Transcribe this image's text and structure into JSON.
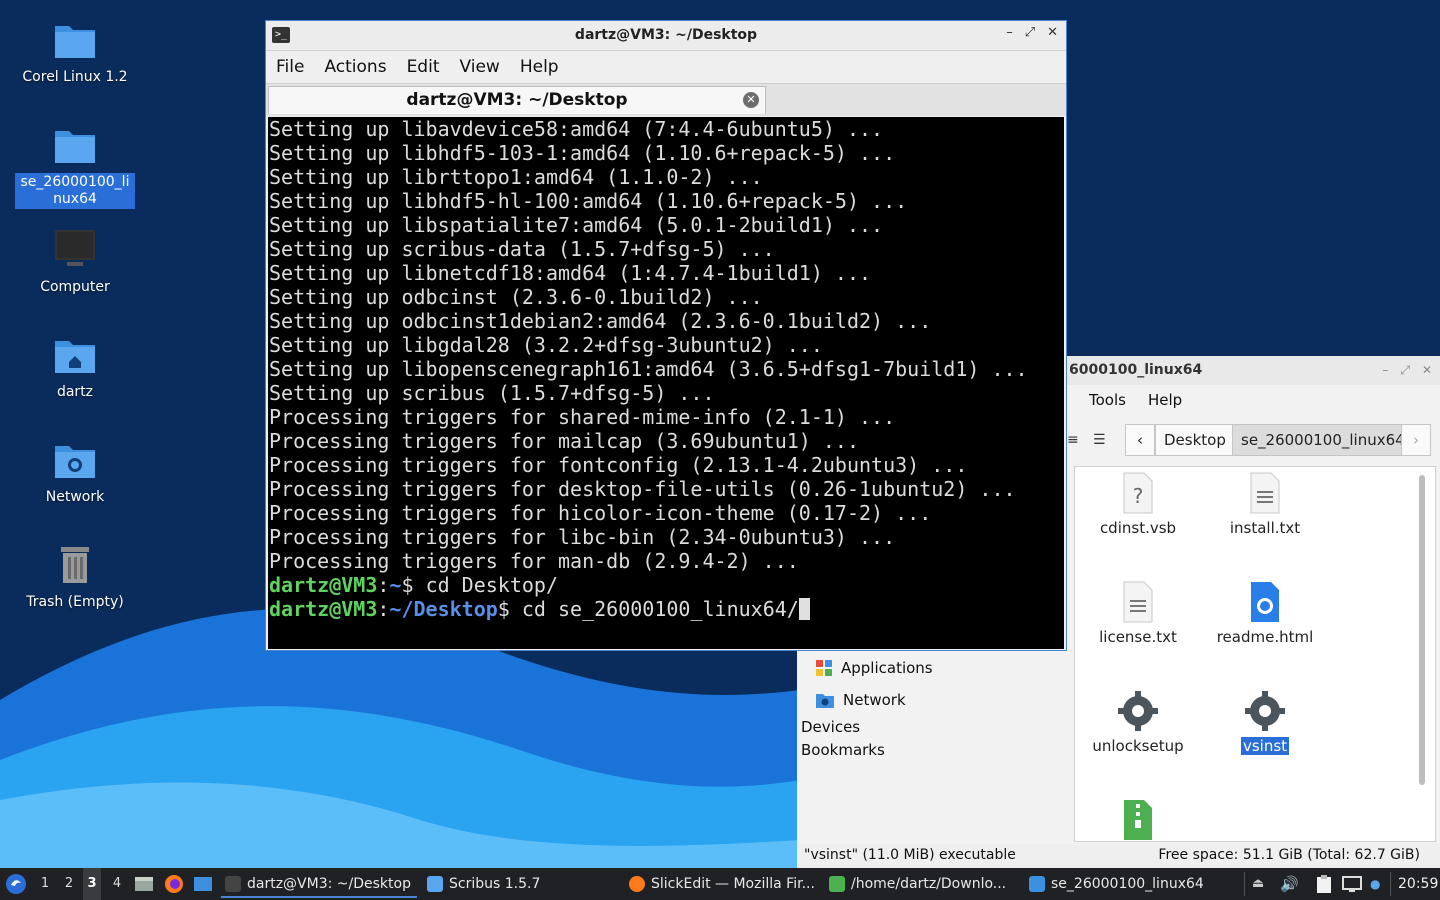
{
  "desktop": {
    "icons": [
      {
        "label": "Corel Linux 1.2"
      },
      {
        "label": "se_26000100_linux64"
      },
      {
        "label": "Computer"
      },
      {
        "label": "dartz"
      },
      {
        "label": "Network"
      },
      {
        "label": "Trash (Empty)"
      }
    ]
  },
  "terminal": {
    "title": "dartz@VM3: ~/Desktop",
    "menu": [
      "File",
      "Actions",
      "Edit",
      "View",
      "Help"
    ],
    "tab_label": "dartz@VM3: ~/Desktop",
    "lines": [
      "Setting up libavdevice58:amd64 (7:4.4-6ubuntu5) ...",
      "Setting up libhdf5-103-1:amd64 (1.10.6+repack-5) ...",
      "Setting up librttopo1:amd64 (1.1.0-2) ...",
      "Setting up libhdf5-hl-100:amd64 (1.10.6+repack-5) ...",
      "Setting up libspatialite7:amd64 (5.0.1-2build1) ...",
      "Setting up scribus-data (1.5.7+dfsg-5) ...",
      "Setting up libnetcdf18:amd64 (1:4.7.4-1build1) ...",
      "Setting up odbcinst (2.3.6-0.1build2) ...",
      "Setting up odbcinst1debian2:amd64 (2.3.6-0.1build2) ...",
      "Setting up libgdal28 (3.2.2+dfsg-3ubuntu2) ...",
      "Setting up libopenscenegraph161:amd64 (3.6.5+dfsg1-7build1) ...",
      "Setting up scribus (1.5.7+dfsg-5) ...",
      "Processing triggers for shared-mime-info (2.1-1) ...",
      "Processing triggers for mailcap (3.69ubuntu1) ...",
      "Processing triggers for fontconfig (2.13.1-4.2ubuntu3) ...",
      "Processing triggers for desktop-file-utils (0.26-1ubuntu2) ...",
      "Processing triggers for hicolor-icon-theme (0.17-2) ...",
      "Processing triggers for libc-bin (2.34-0ubuntu3) ...",
      "Processing triggers for man-db (2.9.4-2) ..."
    ],
    "prompts": [
      {
        "user": "dartz@VM3",
        "sep": ":",
        "path": "~",
        "sym": "$ ",
        "cmd": "cd Desktop/"
      },
      {
        "user": "dartz@VM3",
        "sep": ":",
        "path": "~/Desktop",
        "sym": "$ ",
        "cmd": "cd se_26000100_linux64/"
      }
    ]
  },
  "filemanager": {
    "title_visible": "6000100_linux64",
    "menu": [
      "Tools",
      "Help"
    ],
    "breadcrumbs": [
      "Desktop",
      "se_26000100_linux64"
    ],
    "side": {
      "places": [
        {
          "label": "Applications",
          "icon": "applications-icon"
        },
        {
          "label": "Network",
          "icon": "network-folder-icon"
        }
      ],
      "devices_label": "Devices",
      "bookmarks_label": "Bookmarks"
    },
    "files": [
      {
        "name": "cdinst.vsb",
        "icon": "unknown-file-icon"
      },
      {
        "name": "install.txt",
        "icon": "text-file-icon"
      },
      {
        "name": "license.txt",
        "icon": "text-file-icon"
      },
      {
        "name": "readme.html",
        "icon": "html-file-icon"
      },
      {
        "name": "unlocksetup",
        "icon": "executable-gear-icon"
      },
      {
        "name": "vsinst",
        "icon": "executable-gear-icon"
      },
      {
        "name": "",
        "icon": "archive-file-icon"
      }
    ],
    "status_left": "\"vsinst\" (11.0 MiB) executable",
    "status_right": "Free space: 51.1 GiB (Total: 62.7 GiB)"
  },
  "taskbar": {
    "workspaces": [
      "1",
      "2",
      "3",
      "4"
    ],
    "active_workspace": "3",
    "tasks": [
      {
        "label": "dartz@VM3: ~/Desktop",
        "icon": "terminal-icon"
      },
      {
        "label": "Scribus 1.5.7",
        "icon": "scribus-icon"
      },
      {
        "label": "SlickEdit — Mozilla Fir...",
        "icon": "firefox-icon"
      },
      {
        "label": "/home/dartz/Downlo...",
        "icon": "archive-icon"
      },
      {
        "label": "se_26000100_linux64",
        "icon": "folder-icon"
      }
    ],
    "clock": "20:59"
  },
  "colors": {
    "accent": "#2a6fd8",
    "terminal_bg": "#000000",
    "prompt_user": "#5fd35f",
    "prompt_path": "#5a8fe8",
    "taskbar_bg": "#202124",
    "desktop_bg": "#0a2c5c"
  }
}
